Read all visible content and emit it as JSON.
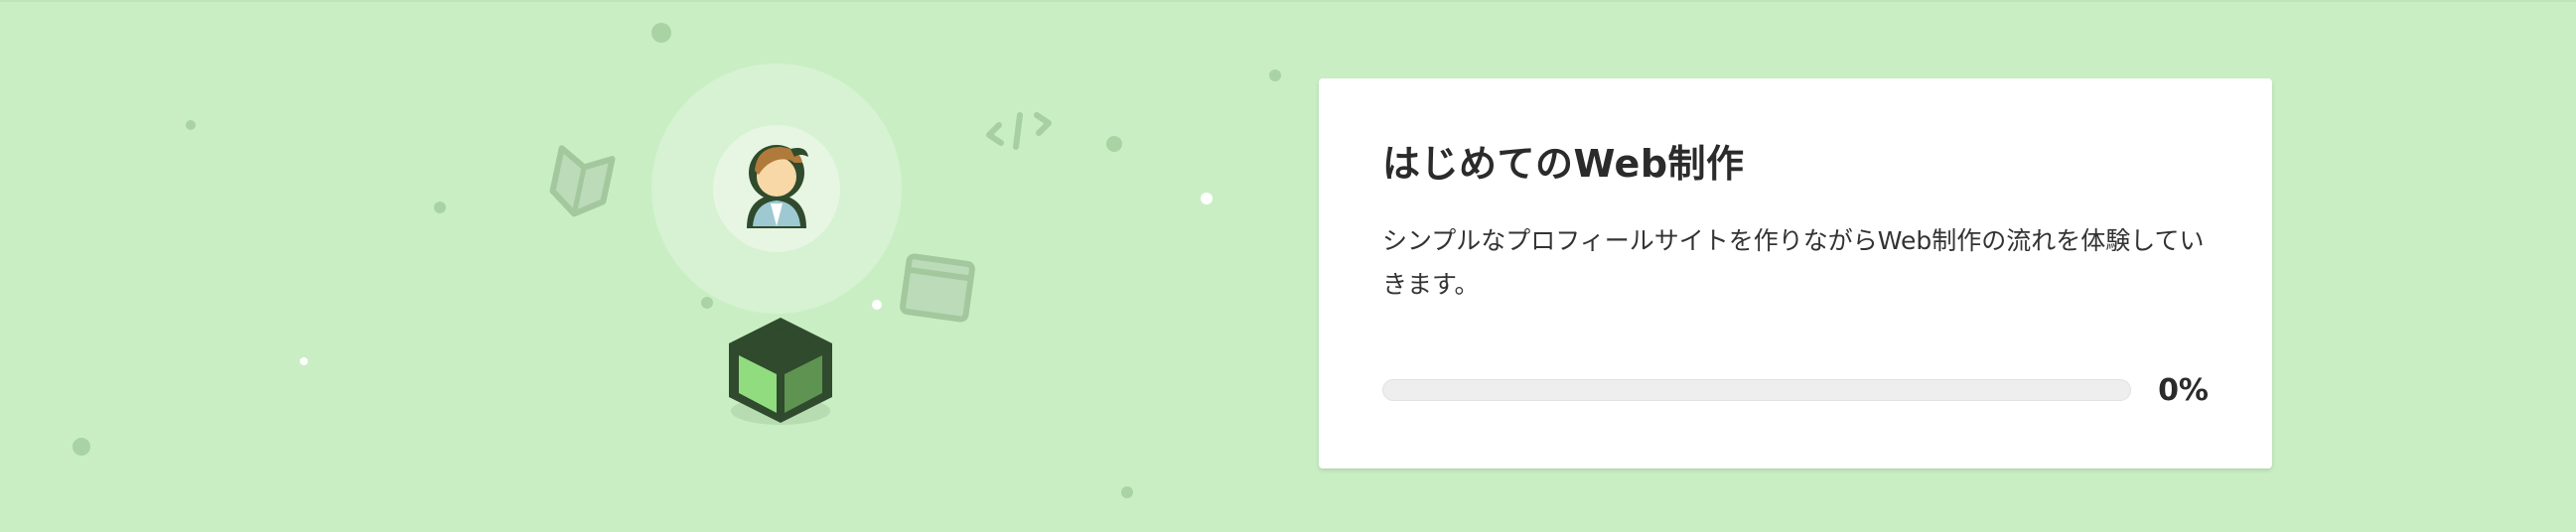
{
  "course": {
    "title": "はじめてのWeb制作",
    "description": "シンプルなプロフィールサイトを作りながらWeb制作の流れを体験していきます。",
    "progress_percent": 0,
    "progress_label": "0%"
  },
  "illustration": {
    "icons": [
      "avatar-icon",
      "cube-icon",
      "beginner-mark-icon",
      "code-tag-icon",
      "browser-window-icon"
    ],
    "colors": {
      "background": "#c9eec4",
      "decoration": "#a7cfa3",
      "dark_green": "#2f4a2c",
      "cube_light": "#8fdc7f",
      "cube_mid": "#5b9150"
    }
  }
}
